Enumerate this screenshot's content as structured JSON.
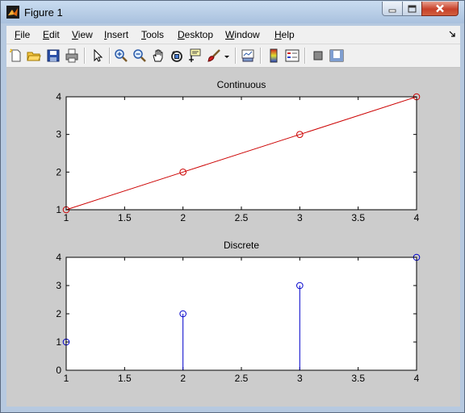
{
  "window": {
    "title": "Figure 1"
  },
  "menu": {
    "items": [
      {
        "underline": "F",
        "rest": "ile"
      },
      {
        "underline": "E",
        "rest": "dit"
      },
      {
        "underline": "V",
        "rest": "iew"
      },
      {
        "underline": "I",
        "rest": "nsert"
      },
      {
        "underline": "T",
        "rest": "ools"
      },
      {
        "underline": "D",
        "rest": "esktop"
      },
      {
        "underline": "W",
        "rest": "indow"
      },
      {
        "underline": "H",
        "rest": "elp"
      }
    ]
  },
  "toolbar": {
    "icons": [
      "new-figure-icon",
      "open-file-icon",
      "save-icon",
      "print-icon",
      "pointer-icon",
      "zoom-in-icon",
      "zoom-out-icon",
      "pan-hand-icon",
      "rotate-3d-icon",
      "data-cursor-icon",
      "brush-icon",
      "brush-dropdown-icon",
      "link-plot-icon",
      "colorbar-icon",
      "legend-icon",
      "hide-plot-tools-icon",
      "show-plot-tools-icon"
    ]
  },
  "chart_data": [
    {
      "type": "line",
      "title": "Continuous",
      "x": [
        1,
        2,
        3,
        4
      ],
      "series": [
        {
          "values": [
            1,
            2,
            3,
            4
          ],
          "color": "#cc0000",
          "marker": "circle"
        }
      ],
      "xlim": [
        1,
        4
      ],
      "ylim": [
        1,
        4
      ],
      "xticks": [
        "1",
        "1.5",
        "2",
        "2.5",
        "3",
        "3.5",
        "4"
      ],
      "yticks": [
        "1",
        "2",
        "3",
        "4"
      ],
      "xlabel": "",
      "ylabel": "",
      "grid": false
    },
    {
      "type": "stem",
      "title": "Discrete",
      "x": [
        1,
        2,
        3,
        4
      ],
      "series": [
        {
          "values": [
            1,
            2,
            3,
            4
          ],
          "color": "#0000cc",
          "marker": "circle"
        }
      ],
      "xlim": [
        1,
        4
      ],
      "ylim": [
        0,
        4
      ],
      "xticks": [
        "1",
        "1.5",
        "2",
        "2.5",
        "3",
        "3.5",
        "4"
      ],
      "yticks": [
        "0",
        "1",
        "2",
        "3",
        "4"
      ],
      "xlabel": "",
      "ylabel": "",
      "grid": false
    }
  ]
}
